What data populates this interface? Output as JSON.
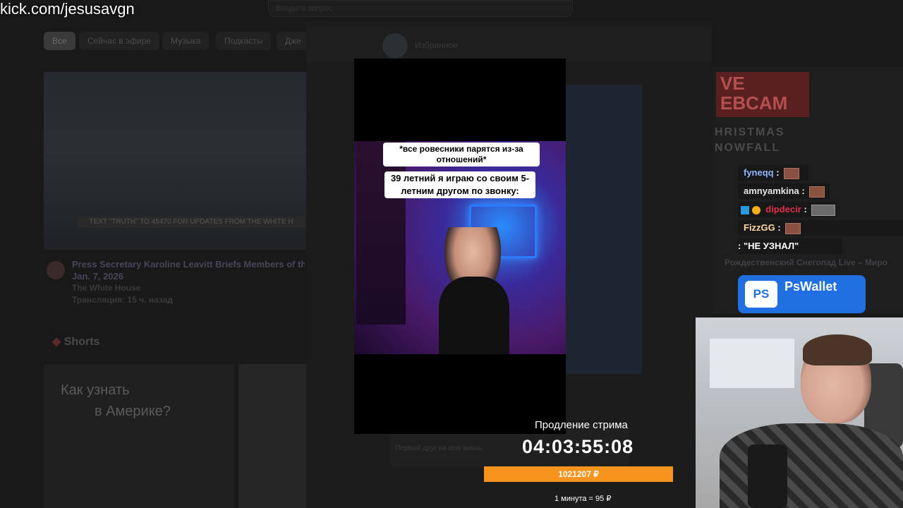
{
  "stream_url": "kick.com/jesusavgn",
  "youtube": {
    "search_placeholder": "Введите запрос",
    "chips": [
      "Все",
      "Сейчас в эфире",
      "Музыка",
      "Подкасты",
      "Дже"
    ],
    "video1": {
      "banner": "TEXT \"TRUTH\" TO 45470 FOR UPDATES FROM THE WHITE H",
      "title": "Press Secretary Karoline Leavitt Briefs Members of the",
      "date": "Jan. 7, 2026",
      "channel": "The White House",
      "meta": "Трансляция: 15 ч. назад"
    },
    "shorts_label": "Shorts",
    "short1_text_a": "Как узнать",
    "short1_text_b": "в Америке?"
  },
  "telegram": {
    "chat_name": "Избранное",
    "msg_preview": "Первый друг на всю жизнь"
  },
  "right_video": {
    "badge_top": "VE",
    "badge_bottom": "EBCAM",
    "subtitle_a": "HRISTMAS",
    "subtitle_b": "NOWFALL",
    "title": "Рождественский Снегопад Live – Миро"
  },
  "chat": {
    "messages": [
      {
        "user": "fyneqq",
        "color": "#8fb4ff",
        "text": ":",
        "emote": true,
        "badges": false
      },
      {
        "user": "amnyamkina",
        "color": "#e6e6e6",
        "text": ":",
        "emote": true,
        "badges": false
      },
      {
        "user": "dipdecir",
        "color": "#e0304a",
        "text": ":",
        "emote": true,
        "badges": true
      },
      {
        "user": "FizzGG",
        "color": "#ffd6a0",
        "text": ":",
        "emote": true,
        "badges": false
      },
      {
        "user": "",
        "color": "#ffffff",
        "text": ": \"НЕ УЗНАЛ\"",
        "emote": false,
        "badges": false
      }
    ]
  },
  "pswallet": {
    "logo": "PS",
    "name": "PsWallet"
  },
  "video": {
    "caption_1": "*все ровесники парятся из-за отношений*",
    "caption_2": "39 летний я играю со своим 5-летним другом по звонку:"
  },
  "subathon": {
    "label": "Продление стрима",
    "timer": "04:03:55:08",
    "amount": "1021207 ₽",
    "progress": 1.0,
    "progress_color": "#f7941d",
    "rate": "1 минута = 95 ₽"
  }
}
